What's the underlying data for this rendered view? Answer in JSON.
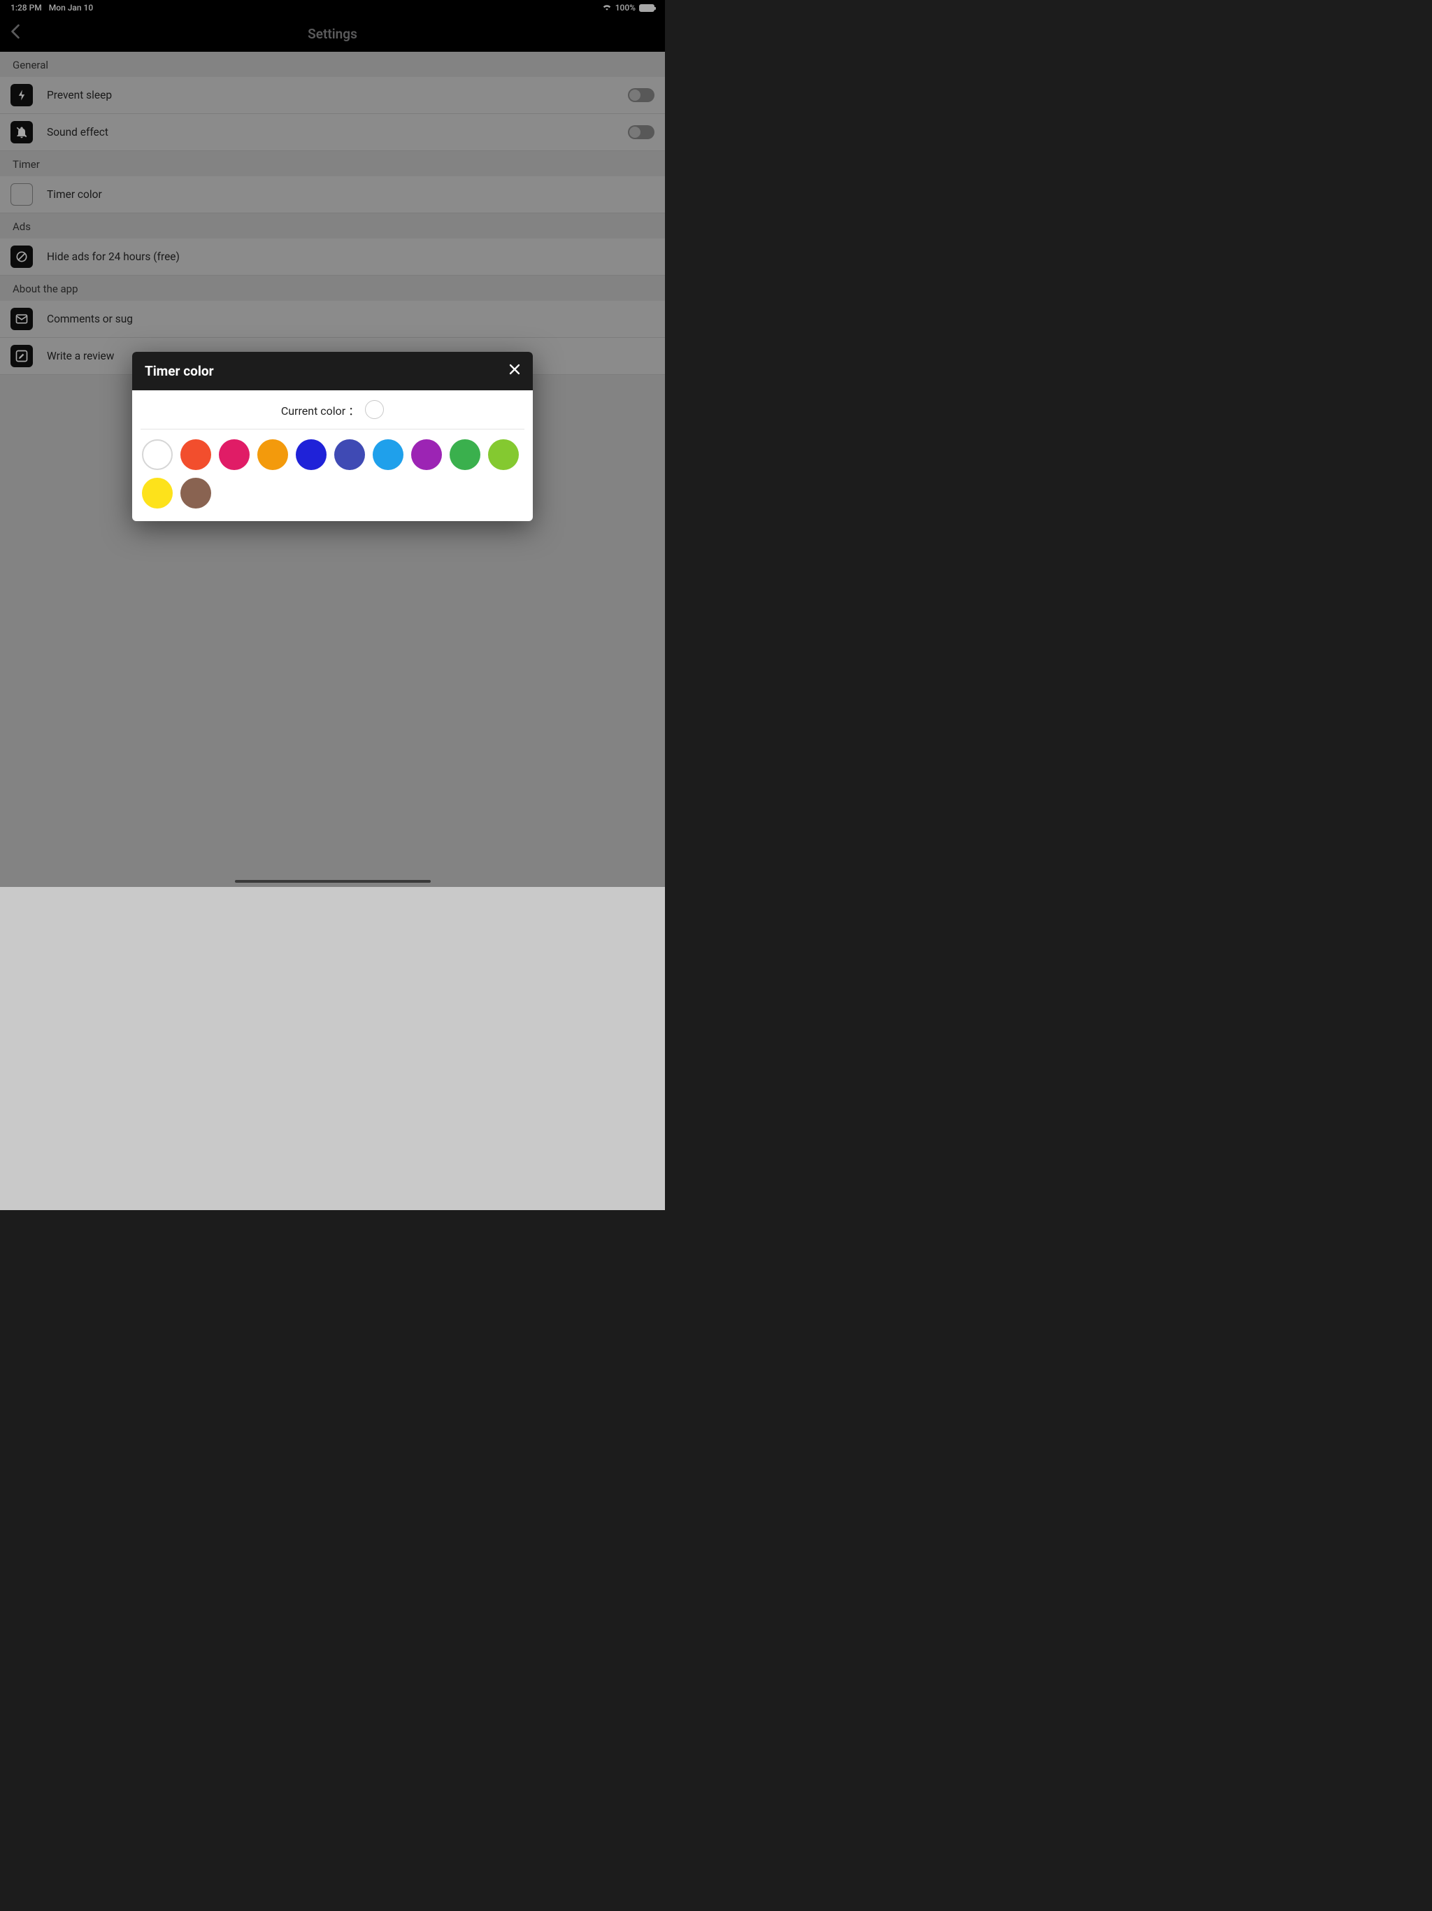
{
  "status": {
    "time": "1:28 PM",
    "date": "Mon Jan 10",
    "battery_pct": "100%"
  },
  "nav": {
    "title": "Settings"
  },
  "sections": {
    "general": {
      "header": "General",
      "prevent_sleep": "Prevent sleep",
      "sound_effect": "Sound effect"
    },
    "timer": {
      "header": "Timer",
      "timer_color": "Timer color"
    },
    "ads": {
      "header": "Ads",
      "hide_ads": "Hide ads for 24 hours (free)"
    },
    "about": {
      "header": "About the app",
      "comments": "Comments or sug",
      "review": "Write a review"
    }
  },
  "modal": {
    "title": "Timer color",
    "current_label": "Current color ：",
    "current_color": "#ffffff",
    "palette": [
      "#ffffff",
      "#f24e2d",
      "#e01c66",
      "#f39a0c",
      "#1f22d8",
      "#3f4ab4",
      "#1fa0eb",
      "#9c24b4",
      "#3ab04d",
      "#84c930",
      "#fde21b",
      "#896351"
    ]
  }
}
